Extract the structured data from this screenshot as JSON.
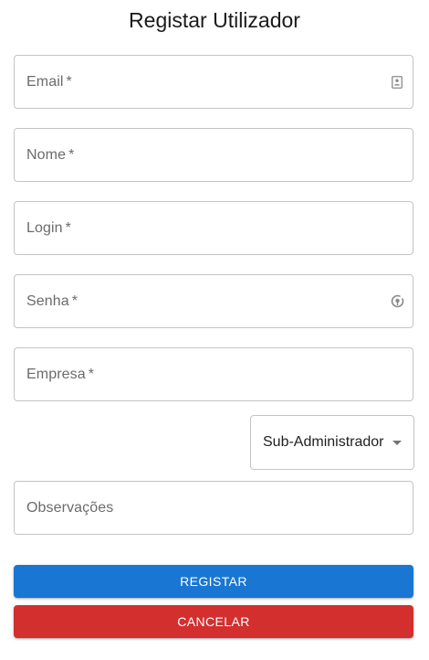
{
  "page": {
    "title": "Registar Utilizador"
  },
  "form": {
    "email": {
      "label": "Email",
      "required_mark": "*",
      "icon": "contact-card-icon"
    },
    "nome": {
      "label": "Nome",
      "required_mark": "*"
    },
    "login": {
      "label": "Login",
      "required_mark": "*"
    },
    "senha": {
      "label": "Senha",
      "required_mark": "*",
      "icon": "password-manager-icon"
    },
    "empresa": {
      "label": "Empresa",
      "required_mark": "*"
    },
    "role": {
      "selected": "Sub-Administrador",
      "icon": "chevron-down-icon"
    },
    "observacoes": {
      "label": "Observações"
    }
  },
  "actions": {
    "register_label": "REGISTAR",
    "cancel_label": "CANCELAR"
  },
  "colors": {
    "primary": "#1976d2",
    "danger": "#d32f2f",
    "border": "#c4c4c4",
    "label": "#6b6b6b"
  }
}
